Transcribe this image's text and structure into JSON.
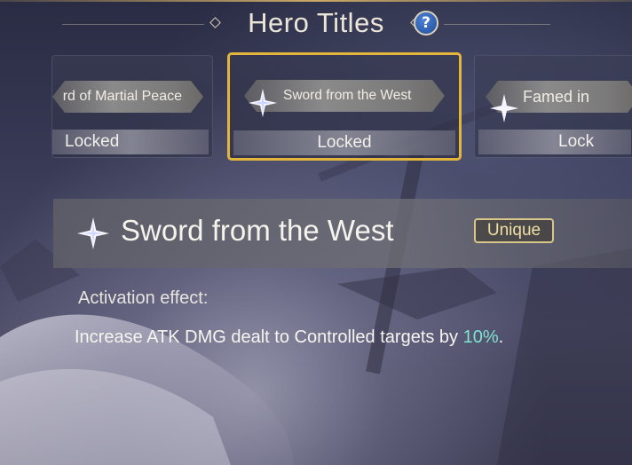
{
  "header": {
    "title": "Hero Titles",
    "help_label": "?"
  },
  "cards": [
    {
      "name": "rd of Martial Peace",
      "status": "Locked",
      "selected": false
    },
    {
      "name": "Sword from the West",
      "status": "Locked",
      "selected": true
    },
    {
      "name": "Famed in",
      "status": "Lock",
      "selected": false
    }
  ],
  "detail": {
    "title": "Sword from the West",
    "badge": "Unique",
    "effect_label": "Activation effect:",
    "effect_text_before": "Increase ATK DMG dealt to Controlled targets by ",
    "effect_value": "10%",
    "effect_text_after": "."
  },
  "colors": {
    "selected_border": "#e3b53b",
    "highlight": "#7ee3d0",
    "badge": "#d9c787",
    "help_button": "#2c5fb5"
  },
  "icons": {
    "title_emblem": "four-point-star-icon"
  }
}
